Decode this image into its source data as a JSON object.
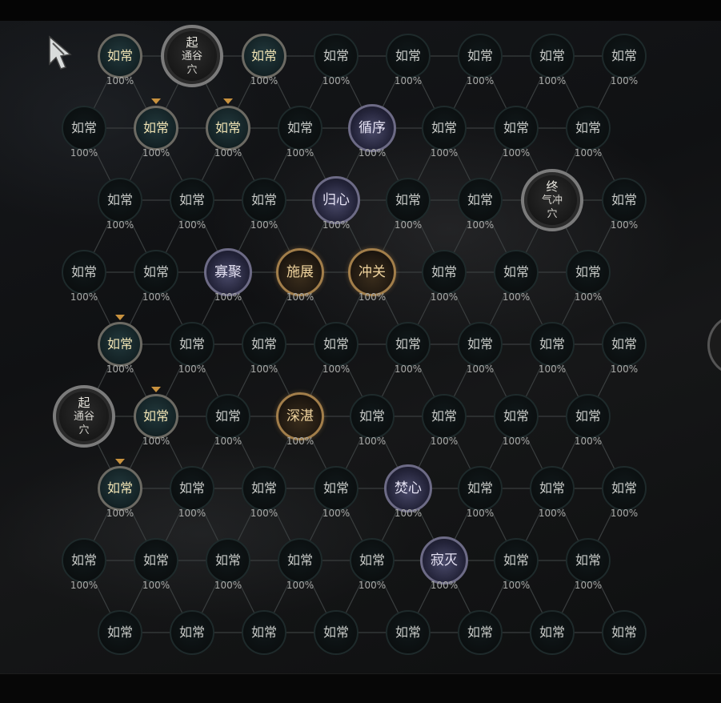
{
  "percent": "100%",
  "nodes": [
    {
      "t": "如常",
      "s": "lit"
    },
    {
      "t": "起",
      "b": "通谷穴",
      "s": "start"
    },
    {
      "t": "如常",
      "s": "lit"
    },
    {
      "t": "如常"
    },
    {
      "t": "如常"
    },
    {
      "t": "如常"
    },
    {
      "t": "如常"
    },
    {
      "t": "如常"
    },
    {
      "t": "如常"
    },
    {
      "t": "如常",
      "s": "lit",
      "m": true
    },
    {
      "t": "如常",
      "s": "lit",
      "m": true
    },
    {
      "t": "如常"
    },
    {
      "t": "循序",
      "s": "skill"
    },
    {
      "t": "如常"
    },
    {
      "t": "如常"
    },
    {
      "t": "如常"
    },
    {
      "t": "如常"
    },
    {
      "t": "如常"
    },
    {
      "t": "如常"
    },
    {
      "t": "归心",
      "s": "skill"
    },
    {
      "t": "如常"
    },
    {
      "t": "如常"
    },
    {
      "t": "终",
      "b": "气冲穴",
      "s": "end"
    },
    {
      "t": "如常"
    },
    {
      "t": "如常"
    },
    {
      "t": "如常"
    },
    {
      "t": "寡聚",
      "s": "skill"
    },
    {
      "t": "施展",
      "s": "gold"
    },
    {
      "t": "冲关",
      "s": "gold"
    },
    {
      "t": "如常"
    },
    {
      "t": "如常"
    },
    {
      "t": "如常"
    },
    {
      "t": "如常",
      "s": "lit",
      "m": true
    },
    {
      "t": "如常"
    },
    {
      "t": "如常"
    },
    {
      "t": "如常"
    },
    {
      "t": "如常"
    },
    {
      "t": "如常"
    },
    {
      "t": "如常"
    },
    {
      "t": "如常"
    },
    {
      "t": "起",
      "b": "通谷穴",
      "s": "start"
    },
    {
      "t": "如常",
      "s": "lit",
      "m": true
    },
    {
      "t": "如常"
    },
    {
      "t": "深湛",
      "s": "gold"
    },
    {
      "t": "如常"
    },
    {
      "t": "如常"
    },
    {
      "t": "如常"
    },
    {
      "t": "如常"
    },
    {
      "t": "如常",
      "s": "lit",
      "m": true
    },
    {
      "t": "如常"
    },
    {
      "t": "如常"
    },
    {
      "t": "如常"
    },
    {
      "t": "焚心",
      "s": "skill"
    },
    {
      "t": "如常"
    },
    {
      "t": "如常"
    },
    {
      "t": "如常"
    },
    {
      "t": "如常"
    },
    {
      "t": "如常"
    },
    {
      "t": "如常"
    },
    {
      "t": "如常"
    },
    {
      "t": "如常"
    },
    {
      "t": "寂灭",
      "s": "skill"
    },
    {
      "t": "如常"
    },
    {
      "t": "如常"
    },
    {
      "t": "如常"
    },
    {
      "t": "如常"
    },
    {
      "t": "如常"
    },
    {
      "t": "如常"
    },
    {
      "t": "如常"
    },
    {
      "t": "如常"
    },
    {
      "t": "如常"
    },
    {
      "t": "如常"
    }
  ],
  "colors": {
    "link": "#3a3e3f",
    "gold": "#c9923e",
    "skill_ring": "#6d6b86",
    "lit_ring": "#6c6a63"
  },
  "icons": {
    "cursor": "feather-cursor-icon",
    "marker": "triangle-down-icon"
  }
}
